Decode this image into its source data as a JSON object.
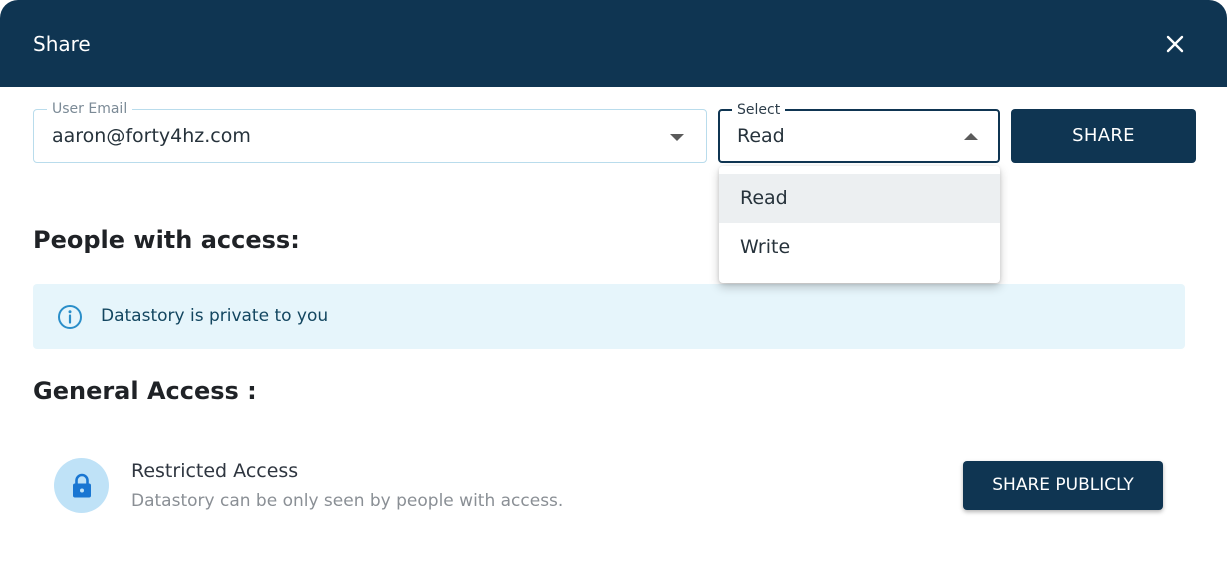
{
  "dialog": {
    "title": "Share"
  },
  "email": {
    "label": "User Email",
    "value": "aaron@forty4hz.com"
  },
  "permission": {
    "label": "Select",
    "value": "Read",
    "options": [
      "Read",
      "Write"
    ]
  },
  "share_button": "SHARE",
  "people_heading": "People with access:",
  "info_banner": {
    "text": "Datastory is private to you",
    "icon": "info-icon"
  },
  "general_heading": "General Access :",
  "access": {
    "title": "Restricted Access",
    "description": "Datastory can be only seen by people with access.",
    "icon": "lock-icon",
    "button": "SHARE PUBLICLY"
  },
  "colors": {
    "primary": "#0f3552",
    "banner_bg": "#e6f5fb",
    "info_icon": "#2a8ec9",
    "lock_bg": "#bfe2f7",
    "lock_icon": "#1976d2"
  }
}
